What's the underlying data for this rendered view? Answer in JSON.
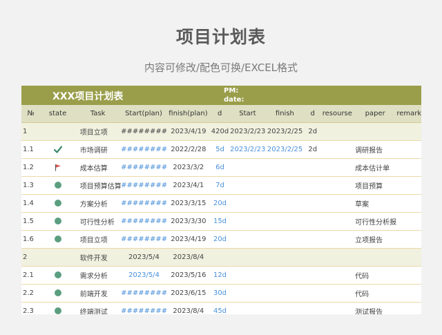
{
  "page": {
    "title": "项目计划表",
    "subtitle": "内容可修改/配色可换/EXCEL格式"
  },
  "sheet": {
    "banner_title": "XXX项目计划表",
    "pm_label": "PM:",
    "date_label": "date:",
    "headers": [
      "№",
      "state",
      "Task",
      "Start(plan)",
      "finish(plan)",
      "d",
      "Start",
      "finish",
      "d",
      "resourse",
      "paper",
      "remarks"
    ],
    "rows": [
      {
        "no": "1",
        "state": "",
        "task": "项目立项",
        "start_plan": "########",
        "finish_plan": "2023/4/19",
        "d": "420d",
        "start": "2023/2/23",
        "finish": "2023/2/25",
        "d2": "2d",
        "resource": "",
        "paper": "",
        "remarks": "",
        "group": true
      },
      {
        "no": "1.1",
        "state": "check-icon",
        "task": "市场调研",
        "start_plan": "########",
        "finish_plan": "2022/2/28",
        "d": "5d",
        "start": "2023/2/23",
        "finish": "2023/2/25",
        "d2": "2d",
        "resource": "",
        "paper": "调研报告",
        "remarks": ""
      },
      {
        "no": "1.2",
        "state": "flag-icon",
        "task": "成本估算",
        "start_plan": "########",
        "finish_plan": "2023/3/2",
        "d": "6d",
        "start": "",
        "finish": "",
        "d2": "",
        "resource": "",
        "paper": "成本估计单",
        "remarks": ""
      },
      {
        "no": "1.3",
        "state": "dot-icon",
        "task": "项目预算估算",
        "start_plan": "########",
        "finish_plan": "2023/4/1",
        "d": "7d",
        "start": "",
        "finish": "",
        "d2": "",
        "resource": "",
        "paper": "项目预算",
        "remarks": ""
      },
      {
        "no": "1.4",
        "state": "dot-icon",
        "task": "方案分析",
        "start_plan": "########",
        "finish_plan": "2023/3/15",
        "d": "20d",
        "start": "",
        "finish": "",
        "d2": "",
        "resource": "",
        "paper": "草案",
        "remarks": ""
      },
      {
        "no": "1.5",
        "state": "dot-icon",
        "task": "可行性分析",
        "start_plan": "########",
        "finish_plan": "2023/3/30",
        "d": "15d",
        "start": "",
        "finish": "",
        "d2": "",
        "resource": "",
        "paper": "可行性分析报告",
        "remarks": ""
      },
      {
        "no": "1.6",
        "state": "dot-icon",
        "task": "项目立项",
        "start_plan": "########",
        "finish_plan": "2023/4/19",
        "d": "20d",
        "start": "",
        "finish": "",
        "d2": "",
        "resource": "",
        "paper": "立项报告",
        "remarks": ""
      },
      {
        "no": "2",
        "state": "",
        "task": "软件开发",
        "start_plan": "2023/5/4",
        "finish_plan": "2023/8/4",
        "d": "",
        "start": "",
        "finish": "",
        "d2": "",
        "resource": "",
        "paper": "",
        "remarks": "",
        "group": true
      },
      {
        "no": "2.1",
        "state": "dot-icon",
        "task": "需求分析",
        "start_plan": "2023/5/4",
        "finish_plan": "2023/5/16",
        "d": "12d",
        "start": "",
        "finish": "",
        "d2": "",
        "resource": "",
        "paper": "代码",
        "remarks": ""
      },
      {
        "no": "2.2",
        "state": "dot-icon",
        "task": "前端开发",
        "start_plan": "########",
        "finish_plan": "2023/6/15",
        "d": "30d",
        "start": "",
        "finish": "",
        "d2": "",
        "resource": "",
        "paper": "代码",
        "remarks": ""
      },
      {
        "no": "2.3",
        "state": "dot-icon",
        "task": "终端测试",
        "start_plan": "########",
        "finish_plan": "2023/8/4",
        "d": "45d",
        "start": "",
        "finish": "",
        "d2": "",
        "resource": "",
        "paper": "测试报告",
        "remarks": ""
      }
    ]
  },
  "colors": {
    "banner": "#9a9e4a",
    "header": "#dfe0c3",
    "group_row": "#f1f1e0",
    "blue_text": "#4a90d9",
    "status_dot": "#5b9e80",
    "check": "#3a8a6a",
    "flag": "#d9534f"
  }
}
